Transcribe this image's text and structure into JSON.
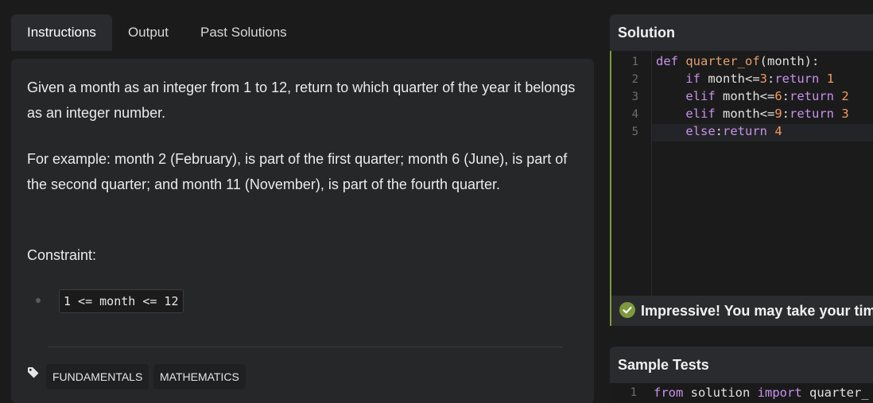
{
  "tabs": [
    {
      "label": "Instructions"
    },
    {
      "label": "Output"
    },
    {
      "label": "Past Solutions"
    }
  ],
  "description": {
    "p1": "Given a month as an integer from 1 to 12, return to which quarter of the year it belongs as an integer number.",
    "p2": "For example: month 2 (February), is part of the first quarter; month 6 (June), is part of the second quarter; and month 11 (November), is part of the fourth quarter.",
    "p3": "Constraint:",
    "constraint": "1 <= month <= 12"
  },
  "tags": [
    "FUNDAMENTALS",
    "MATHEMATICS"
  ],
  "solution": {
    "title": "Solution",
    "line_numbers": [
      "1",
      "2",
      "3",
      "4",
      "5"
    ],
    "code": [
      {
        "parts": [
          {
            "t": "def",
            "c": "kw"
          },
          {
            "t": " ",
            "c": ""
          },
          {
            "t": "quarter_of",
            "c": "fn"
          },
          {
            "t": "(month):",
            "c": ""
          }
        ]
      },
      {
        "parts": [
          {
            "t": "    ",
            "c": ""
          },
          {
            "t": "if",
            "c": "kw"
          },
          {
            "t": " month<=",
            "c": ""
          },
          {
            "t": "3",
            "c": "num"
          },
          {
            "t": ":",
            "c": ""
          },
          {
            "t": "return",
            "c": "kw"
          },
          {
            "t": " ",
            "c": ""
          },
          {
            "t": "1",
            "c": "num"
          }
        ]
      },
      {
        "parts": [
          {
            "t": "    ",
            "c": ""
          },
          {
            "t": "elif",
            "c": "kw"
          },
          {
            "t": " month<=",
            "c": ""
          },
          {
            "t": "6",
            "c": "num"
          },
          {
            "t": ":",
            "c": ""
          },
          {
            "t": "return",
            "c": "kw"
          },
          {
            "t": " ",
            "c": ""
          },
          {
            "t": "2",
            "c": "num"
          }
        ]
      },
      {
        "parts": [
          {
            "t": "    ",
            "c": ""
          },
          {
            "t": "elif",
            "c": "kw"
          },
          {
            "t": " month<=",
            "c": ""
          },
          {
            "t": "9",
            "c": "num"
          },
          {
            "t": ":",
            "c": ""
          },
          {
            "t": "return",
            "c": "kw"
          },
          {
            "t": " ",
            "c": ""
          },
          {
            "t": "3",
            "c": "num"
          }
        ]
      },
      {
        "parts": [
          {
            "t": "    ",
            "c": ""
          },
          {
            "t": "else",
            "c": "kw"
          },
          {
            "t": ":",
            "c": ""
          },
          {
            "t": "return",
            "c": "kw"
          },
          {
            "t": " ",
            "c": ""
          },
          {
            "t": "4",
            "c": "num"
          }
        ]
      }
    ],
    "banner": "Impressive! You may take your time"
  },
  "sample_tests": {
    "title": "Sample Tests",
    "line_number": "1",
    "code": [
      {
        "t": "from",
        "c": "kw"
      },
      {
        "t": " solution ",
        "c": ""
      },
      {
        "t": "import",
        "c": "kw"
      },
      {
        "t": " quarter_",
        "c": ""
      }
    ]
  },
  "colors": {
    "accent": "#7d9a3d",
    "keyword": "#c792ea",
    "function": "#e5a06b",
    "number": "#f49a5b"
  }
}
